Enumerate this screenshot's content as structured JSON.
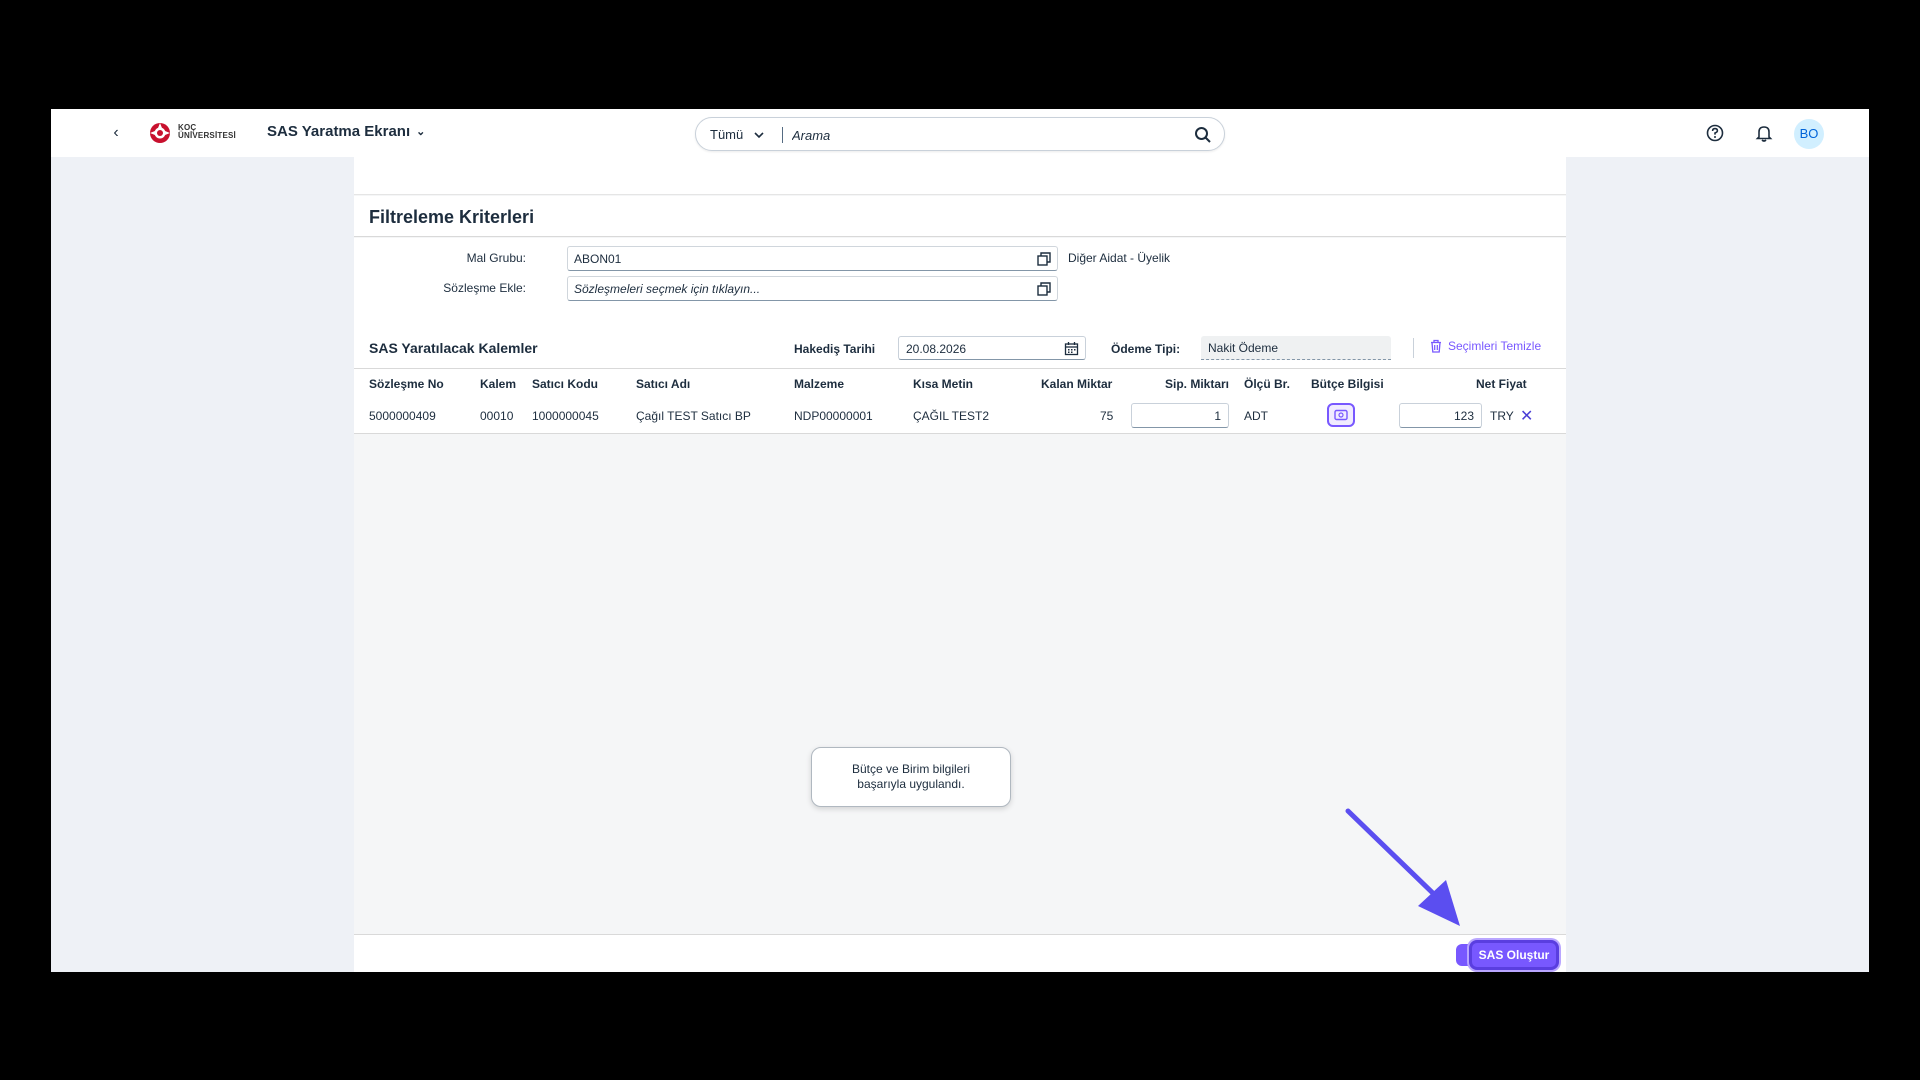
{
  "shellbar": {
    "logo_line1": "KOÇ",
    "logo_line2": "ÜNİVERSİTESİ",
    "app_title": "SAS Yaratma Ekranı",
    "search_scope": "Tümü",
    "search_placeholder": "Arama",
    "avatar_initials": "BO"
  },
  "filter": {
    "title": "Filtreleme Kriterleri",
    "mal_grubu_label": "Mal Grubu:",
    "mal_grubu_value": "ABON01",
    "mal_grubu_desc": "Diğer Aidat - Üyelik",
    "sozlesme_label": "Sözleşme Ekle:",
    "sozlesme_placeholder": "Sözleşmeleri seçmek için tıklayın..."
  },
  "items": {
    "title": "SAS Yaratılacak Kalemler",
    "hakedis_label": "Hakediş Tarihi",
    "hakedis_value": "20.08.2026",
    "odeme_label": "Ödeme Tipi:",
    "odeme_value": "Nakit Ödeme",
    "clear_label": "Seçimleri Temizle",
    "columns": [
      "Sözleşme No",
      "Kalem",
      "Satıcı Kodu",
      "Satıcı Adı",
      "Malzeme",
      "Kısa Metin",
      "Kalan Miktar",
      "Sip. Miktarı",
      "Ölçü Br.",
      "Bütçe Bilgisi",
      "Net Fiyat"
    ],
    "rows": [
      {
        "sozlesme_no": "5000000409",
        "kalem": "00010",
        "satici_kodu": "1000000045",
        "satici_adi": "Çağıl TEST Satıcı BP",
        "malzeme": "NDP00000001",
        "kisa_metin": "ÇAĞIL TEST2",
        "kalan_miktar": "75",
        "sip_miktari": "1",
        "olcu_br": "ADT",
        "net_fiyat": "123",
        "currency": "TRY"
      }
    ]
  },
  "toast": {
    "line1": "Bütçe ve Birim bilgileri",
    "line2": "başarıyla uygulandı."
  },
  "footer": {
    "create_label": "SAS Oluştur"
  },
  "colors": {
    "accent": "#7858ff",
    "arrow": "#5b4ef0"
  }
}
